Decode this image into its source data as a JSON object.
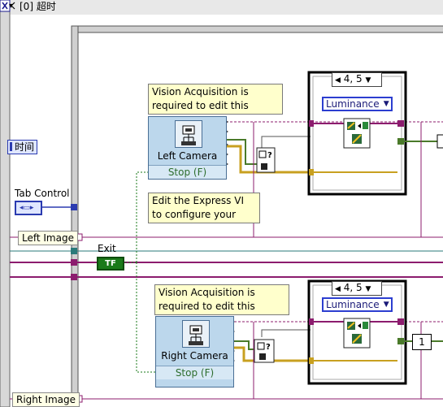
{
  "case_header": {
    "selector": "[0] 超时"
  },
  "left_labels": {
    "time": "时间",
    "tab_control": "Tab Control",
    "exit": "Exit",
    "left_image": "Left Image",
    "right_image": "Right Image",
    "bool_const": "TF"
  },
  "top_block": {
    "note_text": "Vision Acquisition is required to edit this",
    "camera_title": "Left Camera",
    "stop_label": "Stop (F)",
    "edit_note": "Edit the Express VI to configure your",
    "index_selector": "4, 5",
    "luminance": "Luminance"
  },
  "bottom_block": {
    "note_text": "Vision Acquisition is required to edit this",
    "camera_title": "Right Camera",
    "stop_label": "Stop (F)",
    "index_selector": "4, 5",
    "luminance": "Luminance",
    "index_const": "1"
  },
  "colors": {
    "image_wire": "#8c1c6e",
    "refnum_wire": "#4a7a2a",
    "error_wire": "#c8a020",
    "frame": "#000000",
    "bool_wire": "#1a7a1a",
    "tunnel_blue": "#2b3bb0"
  }
}
